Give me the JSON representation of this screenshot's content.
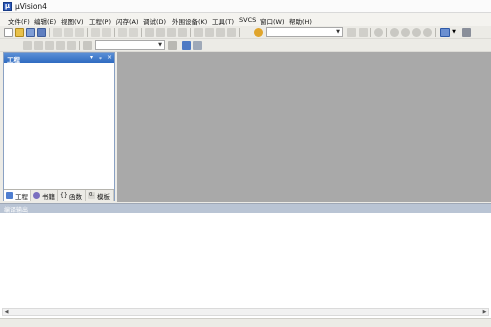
{
  "window": {
    "title": "µVision4"
  },
  "menu": [
    "文件(F)",
    "编辑(E)",
    "视图(V)",
    "工程(P)",
    "闪存(A)",
    "调试(D)",
    "外围设备(K)",
    "工具(T)",
    "SVCS",
    "窗口(W)",
    "帮助(H)"
  ],
  "toolbar": {
    "target_combo_value": "",
    "target_select_value": "",
    "icons_row1": [
      "new-file-icon",
      "open-folder-icon",
      "save-icon",
      "save-all-icon",
      "cut-icon",
      "copy-icon",
      "paste-icon",
      "undo-icon",
      "redo-icon",
      "nav-back-icon",
      "nav-forward-icon",
      "bookmark-icon",
      "prev-bookmark-icon",
      "next-bookmark-icon",
      "clear-bookmarks-icon",
      "indent-icon",
      "unindent-icon",
      "comment-icon",
      "uncomment-icon",
      "find-in-files-icon",
      "find-combo",
      "incremental-find-icon",
      "find-icon",
      "debug-icon",
      "breakpoint-icon",
      "disable-breakpoint-icon",
      "kill-breakpoints-icon",
      "window-select-icon",
      "configure-icon"
    ],
    "icons_row2": [
      "translate-icon",
      "build-icon",
      "rebuild-icon",
      "batch-build-icon",
      "stop-build-icon",
      "download-icon",
      "target-select",
      "target-options-icon",
      "manage-components-icon",
      "books-icon"
    ]
  },
  "project_panel": {
    "title": "工程",
    "tabs": [
      {
        "label": "工程",
        "icon": "project-icon",
        "active": true
      },
      {
        "label": "书籍",
        "icon": "books-icon",
        "active": false
      },
      {
        "label": "函数",
        "icon": "functions-icon",
        "active": false
      },
      {
        "label": "模板",
        "icon": "templates-icon",
        "active": false
      }
    ]
  },
  "build_output": {
    "title": "编译输出"
  },
  "colors": {
    "panel_header": "#3a78cb",
    "editor_bg": "#a9a9a9",
    "build_header": "#b9c4d4"
  }
}
